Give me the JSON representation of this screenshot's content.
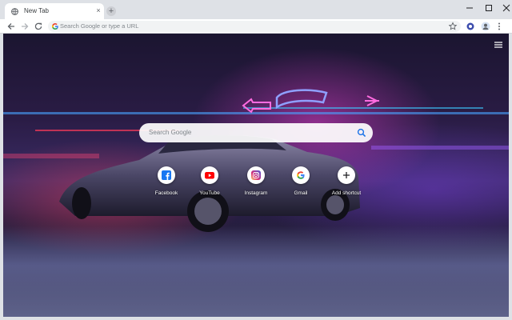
{
  "tab": {
    "title": "New Tab",
    "close": "×",
    "new_tab": "+"
  },
  "omnibox": {
    "placeholder": "Search Google or type a URL"
  },
  "search": {
    "placeholder": "Search Google"
  },
  "shortcuts": [
    {
      "label": "Facebook",
      "icon": "facebook-icon"
    },
    {
      "label": "YouTube",
      "icon": "youtube-icon"
    },
    {
      "label": "Instagram",
      "icon": "instagram-icon"
    },
    {
      "label": "Gmail",
      "icon": "google-icon"
    },
    {
      "label": "Add shortcut",
      "icon": "add-icon"
    }
  ],
  "colors": {
    "chrome_frame": "#dee1e6",
    "toolbar": "#ffffff",
    "omnibox": "#f1f3f4",
    "accent_blue": "#1a73e8"
  }
}
